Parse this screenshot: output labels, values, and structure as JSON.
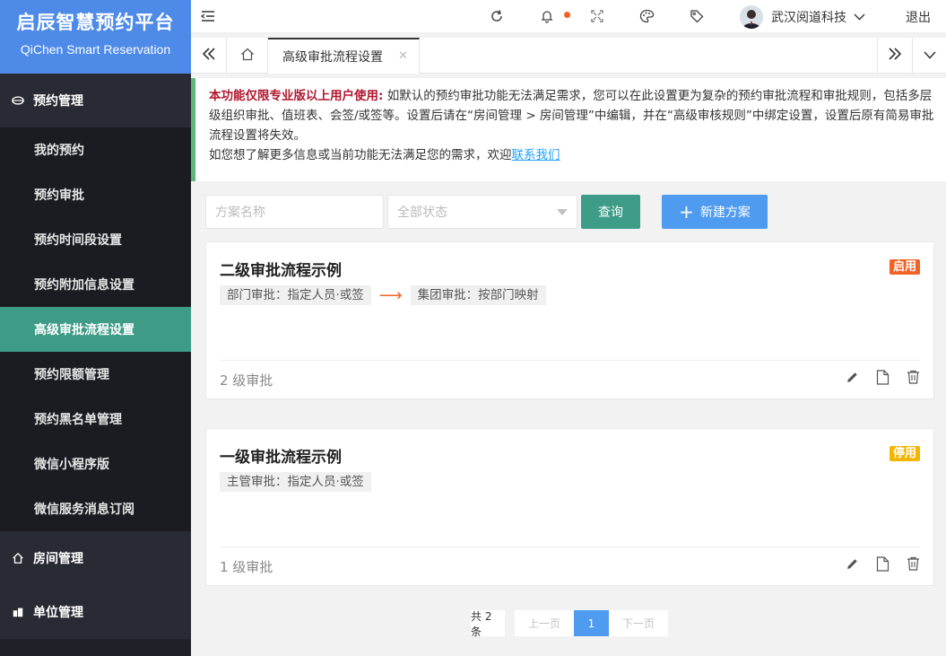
{
  "brand": {
    "title": "启辰智慧预约平台",
    "subtitle": "QiChen Smart Reservation"
  },
  "sidebar": {
    "group_booking": "预约管理",
    "items": [
      "我的预约",
      "预约审批",
      "预约时间段设置",
      "预约附加信息设置",
      "高级审批流程设置",
      "预约限额管理",
      "预约黑名单管理",
      "微信小程序版",
      "微信服务消息订阅"
    ],
    "active_index": 4,
    "group_room": "房间管理",
    "group_unit": "单位管理"
  },
  "header": {
    "user_name": "武汉阅道科技",
    "logout": "退出"
  },
  "tabs": {
    "active_label": "高级审批流程设置"
  },
  "notice": {
    "strong": "本功能仅限专业版以上用户使用:",
    "text": " 如默认的预约审批功能无法满足需求，您可以在此设置更为复杂的预约审批流程和审批规则，包括多层级组织审批、值班表、会签/或签等。设置后请在“房间管理 > 房间管理”中编辑，并在“高级审核规则”中绑定设置，设置后原有简易审批流程设置将失效。",
    "line2": "如您想了解更多信息或当前功能无法满足您的需求，欢迎",
    "link": "联系我们"
  },
  "filters": {
    "name_placeholder": "方案名称",
    "status_placeholder": "全部状态",
    "query_label": "查询",
    "new_label": "新建方案"
  },
  "colors": {
    "accent_green": "#3d9b86",
    "accent_blue": "#4e8ae8",
    "badge_on": "#f26224",
    "badge_off": "#f3b600"
  },
  "cards": [
    {
      "title": "二级审批流程示例",
      "status": "启用",
      "steps": [
        "部门审批：指定人员·或签",
        "集团审批：按部门映射"
      ],
      "level": "2 级审批"
    },
    {
      "title": "一级审批流程示例",
      "status": "停用",
      "steps": [
        "主管审批：指定人员·或签"
      ],
      "level": "1 级审批"
    }
  ],
  "pagination": {
    "total": "共 2 条",
    "prev": "上一页",
    "page": "1",
    "next": "下一页"
  }
}
